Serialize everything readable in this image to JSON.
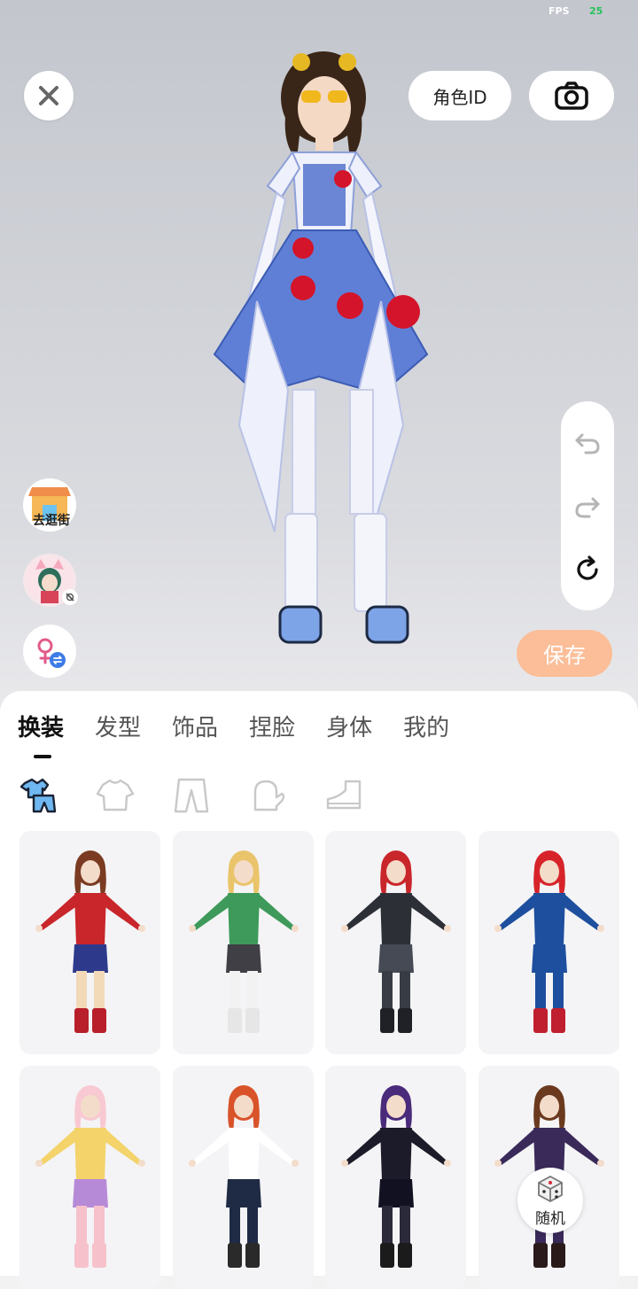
{
  "status": {
    "fps_label": "FPS",
    "fps_value": "25"
  },
  "top_bar": {
    "role_id_label": "角色ID",
    "close_icon": "close-icon",
    "camera_icon": "camera-icon"
  },
  "side": {
    "shop_label": "去逛街",
    "shop_icon": "shop-icon",
    "profile_icon": "avatar-thumbnail",
    "gender_icon": "female-swap-icon"
  },
  "history": {
    "undo_icon": "undo-icon",
    "redo_icon": "redo-icon",
    "reset_icon": "reset-icon"
  },
  "save_label": "保存",
  "tabs": [
    {
      "label": "换装",
      "active": true
    },
    {
      "label": "发型",
      "active": false
    },
    {
      "label": "饰品",
      "active": false
    },
    {
      "label": "捏脸",
      "active": false
    },
    {
      "label": "身体",
      "active": false
    },
    {
      "label": "我的",
      "active": false
    }
  ],
  "subcategories": [
    "outfit-set-icon",
    "top-icon",
    "pants-icon",
    "gloves-icon",
    "shoes-icon"
  ],
  "outfits": [
    {
      "name": "heroine-red-blue",
      "colors": {
        "hair": "#7b3b22",
        "top": "#c8262b",
        "bottom": "#2d3a8c",
        "legs": "#f2d9b8",
        "boots": "#b81f2a"
      }
    },
    {
      "name": "green-robe",
      "colors": {
        "hair": "#e9c46a",
        "top": "#3e9a5a",
        "bottom": "#3f3f45",
        "legs": "#f2f2f2",
        "boots": "#e6e6e6"
      }
    },
    {
      "name": "dark-armor",
      "colors": {
        "hair": "#c8262b",
        "top": "#2c2f36",
        "bottom": "#454a55",
        "legs": "#383c45",
        "boots": "#1f2127"
      }
    },
    {
      "name": "captain-suit",
      "colors": {
        "hair": "#d6242a",
        "top": "#1d4f9e",
        "bottom": "#1d4f9e",
        "legs": "#1d4f9e",
        "boots": "#c01f2f"
      }
    },
    {
      "name": "pink-cat",
      "colors": {
        "hair": "#f8c9d3",
        "top": "#f3d36a",
        "bottom": "#b78ad8",
        "legs": "#f7c1cb",
        "boots": "#f7c1cb"
      }
    },
    {
      "name": "casual-tee",
      "colors": {
        "hair": "#d9532a",
        "top": "#ffffff",
        "bottom": "#1f2a44",
        "legs": "#1f2a44",
        "boots": "#2a2a2a"
      }
    },
    {
      "name": "gothic-dress",
      "colors": {
        "hair": "#4a2a7a",
        "top": "#1b1b2a",
        "bottom": "#111122",
        "legs": "#2a2a3a",
        "boots": "#1b1b1b"
      }
    },
    {
      "name": "academy-coat",
      "colors": {
        "hair": "#6b3a1e",
        "top": "#3a2a5a",
        "bottom": "#7a3b22",
        "legs": "#3a2a5a",
        "boots": "#2a1a1a"
      }
    }
  ],
  "random_label": "随机",
  "random_icon": "dice-icon"
}
